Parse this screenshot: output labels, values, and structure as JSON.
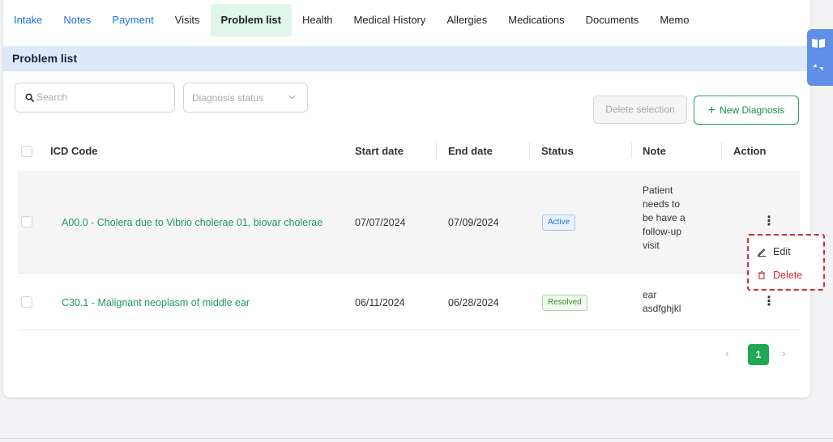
{
  "tabs": [
    {
      "label": "Intake",
      "style": "blue"
    },
    {
      "label": "Notes",
      "style": "blue"
    },
    {
      "label": "Payment",
      "style": "blue"
    },
    {
      "label": "Visits",
      "style": "normal"
    },
    {
      "label": "Problem list",
      "style": "active"
    },
    {
      "label": "Health",
      "style": "normal"
    },
    {
      "label": "Medical History",
      "style": "normal"
    },
    {
      "label": "Allergies",
      "style": "normal"
    },
    {
      "label": "Medications",
      "style": "normal"
    },
    {
      "label": "Documents",
      "style": "normal"
    },
    {
      "label": "Memo",
      "style": "normal"
    }
  ],
  "section": {
    "title": "Problem list"
  },
  "filters": {
    "search_placeholder": "Search",
    "status_placeholder": "Diagnosis status"
  },
  "actions": {
    "delete_selection": "Delete selection",
    "new_diagnosis_plus": "+",
    "new_diagnosis": "New Diagnosis"
  },
  "table": {
    "headers": {
      "icd_code": "ICD Code",
      "start_date": "Start date",
      "end_date": "End date",
      "status": "Status",
      "note": "Note",
      "action": "Action"
    },
    "rows": [
      {
        "icd": "A00.0 - Cholera due to Vibrio cholerae 01, biovar cholerae",
        "start": "07/07/2024",
        "end": "07/09/2024",
        "status": "Active",
        "note_lines": [
          "Patient",
          "needs to",
          "be have a",
          "follow-up",
          "visit"
        ]
      },
      {
        "icd": "C30.1 - Malignant neoplasm of middle ear",
        "start": "06/11/2024",
        "end": "06/28/2024",
        "status": "Resolved",
        "note_lines": [
          "ear",
          "asdfghjkl"
        ]
      }
    ]
  },
  "row_menu": {
    "edit": "Edit",
    "delete": "Delete"
  },
  "pagination": {
    "prev": "‹",
    "current_page": "1",
    "next": "›"
  },
  "colors": {
    "accent_green": "#1ea854",
    "link_blue": "#1e6fd9",
    "danger_red": "#d22a2a",
    "header_band": "#dce9fb"
  }
}
